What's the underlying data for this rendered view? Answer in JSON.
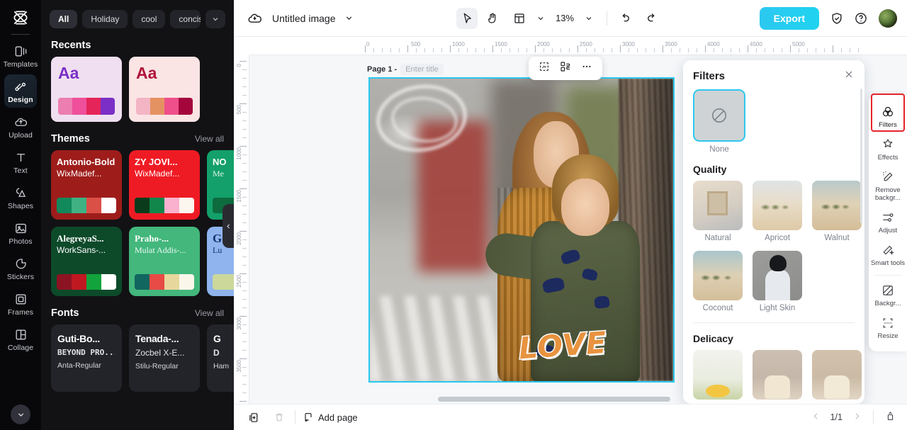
{
  "app": {
    "left_rail": {
      "logo_icon": "capcut-logo-icon",
      "items": [
        {
          "label": "Templates",
          "icon": "templates-icon",
          "active": false
        },
        {
          "label": "Design",
          "icon": "design-icon",
          "active": true
        },
        {
          "label": "Upload",
          "icon": "upload-cloud-icon",
          "active": false
        },
        {
          "label": "Text",
          "icon": "text-icon",
          "active": false
        },
        {
          "label": "Shapes",
          "icon": "shapes-icon",
          "active": false
        },
        {
          "label": "Photos",
          "icon": "photos-icon",
          "active": false
        },
        {
          "label": "Stickers",
          "icon": "stickers-icon",
          "active": false
        },
        {
          "label": "Frames",
          "icon": "frames-icon",
          "active": false
        },
        {
          "label": "Collage",
          "icon": "collage-icon",
          "active": false
        }
      ],
      "more_icon": "chevron-down-icon"
    },
    "panel": {
      "chips": [
        {
          "label": "All",
          "selected": true
        },
        {
          "label": "Holiday",
          "selected": false
        },
        {
          "label": "cool",
          "selected": false
        },
        {
          "label": "concise",
          "selected": false
        }
      ],
      "chips_expand_icon": "chevron-down-icon",
      "sections": {
        "recents": {
          "title": "Recents",
          "cards": [
            {
              "sample": "Aa",
              "bg": "#f0dff0",
              "text_color": "#7b2fc7",
              "swatches": [
                "#ec7eb1",
                "#ef4f9b",
                "#e5255a",
                "#7b2fc7"
              ]
            },
            {
              "sample": "Aa",
              "bg": "#fbe4e4",
              "text_color": "#b01239",
              "swatches": [
                "#f3b5c3",
                "#e59263",
                "#ef4f8b",
                "#a4063c"
              ]
            }
          ]
        },
        "themes": {
          "title": "Themes",
          "view_all": "View all",
          "cards": [
            {
              "font1": "Antonio-Bold",
              "font2": "WixMadef...",
              "bg": "#9e1d1b",
              "fg": "#ffffff",
              "swatches": [
                "#12895a",
                "#3fb183",
                "#da4f46",
                "#ffffff"
              ]
            },
            {
              "font1": "ZY JOVI...",
              "font2": "WixMadef...",
              "bg": "#ef1b24",
              "fg": "#ffffff",
              "swatches": [
                "#0c3b1c",
                "#11874c",
                "#f9b1cd",
                "#fbf6ee"
              ]
            },
            {
              "font1": "NO",
              "font2": "Me",
              "bg": "#13a06a",
              "fg": "#ffffff",
              "swatches": [
                "#0d6b3e",
                "#0d6b3e",
                "#0d6b3e",
                "#0d6b3e"
              ]
            },
            {
              "font1": "AlegreyaS...",
              "font2": "WorkSans-...",
              "bg": "#0d4a2a",
              "fg": "#ffffff",
              "swatches": [
                "#8c1322",
                "#c01821",
                "#12a33c",
                "#ffffff"
              ]
            },
            {
              "font1": "Praho-...",
              "font2": "Mulat Addis-...",
              "bg": "#43b77c",
              "fg": "#ffffff",
              "swatches": [
                "#11665f",
                "#e84a45",
                "#e8d79c",
                "#fbf6ea"
              ]
            },
            {
              "font1": "G",
              "font2": "Lu",
              "bg": "#8fb4ee",
              "fg": "#15316b",
              "swatches": [
                "#cbd89a",
                "#cbd89a",
                "#cbd89a",
                "#cbd89a"
              ]
            }
          ],
          "next_icon": "chevron-right-icon"
        },
        "fonts": {
          "title": "Fonts",
          "view_all": "View all",
          "cards": [
            {
              "line1": "Guti-Bo...",
              "line2": "BEYOND PRO...",
              "line3": "Anta-Regular"
            },
            {
              "line1": "Tenada-...",
              "line2": "Zocbel X-E...",
              "line3": "Stilu-Regular"
            },
            {
              "line1": "G",
              "line2": "D",
              "line3": "Ham"
            }
          ],
          "next_icon": "chevron-right-icon"
        }
      },
      "collapse_icon": "chevron-left-icon"
    },
    "topbar": {
      "cloud_icon": "cloud-save-icon",
      "doc_title": "Untitled image",
      "title_caret_icon": "chevron-down-icon",
      "tools": [
        {
          "name": "select-tool",
          "icon": "cursor-icon",
          "selected": true
        },
        {
          "name": "hand-tool",
          "icon": "hand-icon",
          "selected": false
        },
        {
          "name": "layout-tool",
          "icon": "layout-icon",
          "selected": false
        }
      ],
      "layout_caret_icon": "chevron-down-icon",
      "zoom_value": "13%",
      "zoom_caret_icon": "chevron-down-icon",
      "undo_icon": "undo-icon",
      "redo_icon": "redo-icon",
      "export_label": "Export",
      "shield_icon": "shield-check-icon",
      "help_icon": "question-circle-icon",
      "avatar_name": "user-avatar"
    },
    "ruler": {
      "h_ticks": [
        "0",
        "500",
        "1000",
        "1500",
        "2000",
        "2500",
        "3000",
        "3500",
        "4000",
        "4500",
        "5000"
      ],
      "v_ticks": [
        "0",
        "500",
        "1000",
        "1500",
        "2000",
        "2500",
        "3000",
        "3500"
      ]
    },
    "canvas": {
      "page_label": "Page 1 -",
      "title_placeholder": "Enter title",
      "float_tools": [
        {
          "name": "crop-tool",
          "icon": "crop-icon"
        },
        {
          "name": "replace-tool",
          "icon": "replace-icon"
        },
        {
          "name": "more-tool",
          "icon": "more-horizontal-icon"
        }
      ],
      "image_overlay_text": "LOVE",
      "selection_color": "#28c8f0"
    },
    "filters_panel": {
      "title": "Filters",
      "close_icon": "close-icon",
      "none": {
        "label": "None",
        "icon": "no-filter-icon",
        "selected": true
      },
      "groups": [
        {
          "title": "Quality",
          "items": [
            {
              "label": "Natural",
              "thumb": "th-room"
            },
            {
              "label": "Apricot",
              "thumb": "th-desert"
            },
            {
              "label": "Walnut",
              "thumb": "th-desert2"
            },
            {
              "label": "Coconut",
              "thumb": "th-coco"
            },
            {
              "label": "Light Skin",
              "thumb": "th-skin"
            }
          ]
        },
        {
          "title": "Delicacy",
          "items": [
            {
              "label": "",
              "thumb": "th-cake1"
            },
            {
              "label": "",
              "thumb": "th-cake2"
            },
            {
              "label": "",
              "thumb": "th-cake3"
            }
          ]
        }
      ]
    },
    "right_rail": {
      "items": [
        {
          "label": "Filters",
          "icon": "filters-icon",
          "active": true
        },
        {
          "label": "Effects",
          "icon": "effects-icon",
          "active": false
        },
        {
          "label": "Remove backgr...",
          "icon": "remove-background-icon",
          "active": false
        },
        {
          "label": "Adjust",
          "icon": "adjust-sliders-icon",
          "active": false
        },
        {
          "label": "Smart tools",
          "icon": "smart-tools-icon",
          "active": false
        },
        {
          "label": "Backgr...",
          "icon": "background-icon",
          "active": false
        },
        {
          "label": "Resize",
          "icon": "resize-icon",
          "active": false
        }
      ],
      "highlight_color": "#e8232a"
    },
    "bottombar": {
      "duplicate_icon": "duplicate-page-icon",
      "delete_icon": "trash-icon",
      "add_page_label": "Add page",
      "add_page_icon": "add-page-icon",
      "prev_icon": "chevron-left-icon",
      "page_indicator": "1/1",
      "next_icon": "chevron-right-icon",
      "panel_toggle_icon": "pages-panel-icon"
    }
  }
}
